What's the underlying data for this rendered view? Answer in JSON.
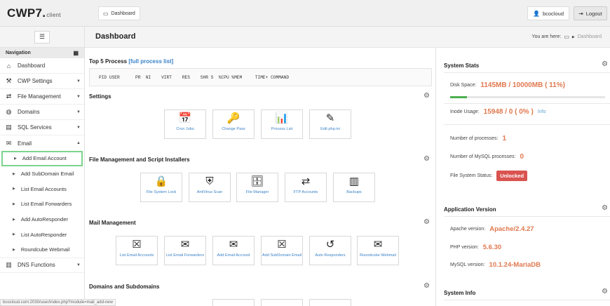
{
  "header": {
    "logo_main": "CWP7",
    "logo_dot": ".",
    "logo_sub": "client",
    "dashboard_tab": "Dashboard",
    "user": "bcocloud",
    "logout": "Logout"
  },
  "sidebar": {
    "nav_label": "Navigation",
    "items": [
      {
        "label": "Dashboard",
        "icon": "home-icon"
      },
      {
        "label": "CWP Settings",
        "icon": "wrench-icon"
      },
      {
        "label": "File Management",
        "icon": "exchange-icon"
      },
      {
        "label": "Domains",
        "icon": "globe-icon"
      },
      {
        "label": "SQL Services",
        "icon": "database-icon"
      },
      {
        "label": "Email",
        "icon": "envelope-icon"
      }
    ],
    "email_sub": [
      "Add Email Account",
      "Add SubDomain Email",
      "List Email Accounts",
      "List Email Forwarders",
      "Add AutoResponder",
      "List AutoResponder",
      "Roundcube Webmail"
    ],
    "dns": "DNS Functions"
  },
  "page": {
    "title": "Dashboard",
    "you_are_here": "You are here:",
    "crumb_current": "Dashboard"
  },
  "top_process": {
    "title": "Top 5 Process",
    "link": "[full process list]",
    "header_line": "PID USER      PR  NI    VIRT    RES    SHR S  %CPU %MEM     TIME+ COMMAND"
  },
  "settings": {
    "title": "Settings",
    "tiles": [
      "Cron Jobs",
      "Change Pass",
      "Process List",
      "Edit php.ini"
    ]
  },
  "file_mgmt": {
    "title": "File Management and Script Installers",
    "tiles": [
      "File System Lock",
      "AntiVirus Scan",
      "File Manager",
      "FTP Accounts",
      "Backups"
    ]
  },
  "mail_mgmt": {
    "title": "Mail Management",
    "tiles": [
      "List Email Accounts",
      "List Email Forwarders",
      "Add Email Account",
      "Add SubDomain Email",
      "Auto Responders",
      "Roundcube Webmail"
    ]
  },
  "domains": {
    "title": "Domains and Subdomains"
  },
  "system_stats": {
    "title": "System Stats",
    "disk_label": "Disk Space:",
    "disk_value": "1145MB / 10000MB ( 11%)",
    "disk_fraction": 0.11,
    "inode_label": "Inode Usage:",
    "inode_value": "15948 / 0 ( 0% )",
    "inode_info": "Info",
    "proc_label": "Number of processes:",
    "proc_value": "1",
    "mysql_proc_label": "Number of MySQL processes:",
    "mysql_proc_value": "0",
    "fs_label": "File System Status:",
    "fs_value": "Unlocked"
  },
  "app_version": {
    "title": "Application Version",
    "apache_label": "Apache version:",
    "apache_value": "Apache/2.4.27",
    "php_label": "PHP version:",
    "php_value": "5.6.30",
    "mysql_label": "MySQL version:",
    "mysql_value": "10.1.24-MariaDB"
  },
  "system_info": {
    "title": "System Info"
  },
  "statusbar": {
    "url": "bcocloud.com:2030/user/index.php?module=mail_add-new"
  },
  "colors": {
    "accent_link": "#3b83c8",
    "value_orange": "#e0784f",
    "badge_red": "#d9534f",
    "highlight_green": "#7cd48f",
    "progress_green": "#4caf50"
  }
}
